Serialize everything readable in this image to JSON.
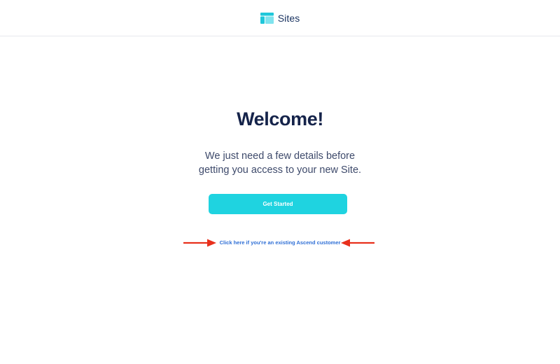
{
  "header": {
    "app_name": "Sites",
    "icon": "sites-layout-icon"
  },
  "main": {
    "title": "Welcome!",
    "subtitle_line1": "We just need a few details before",
    "subtitle_line2": "getting you access to your new Site.",
    "cta_label": "Get Started",
    "existing_customer_link": "Click here if you're an existing Ascend customer"
  },
  "annotations": {
    "left_arrow_icon": "arrow-right-icon",
    "right_arrow_icon": "arrow-left-icon"
  },
  "colors": {
    "accent": "#1fd3e0",
    "link": "#2f6fd6",
    "title": "#15234a",
    "annotation_arrow": "#e8301c"
  }
}
